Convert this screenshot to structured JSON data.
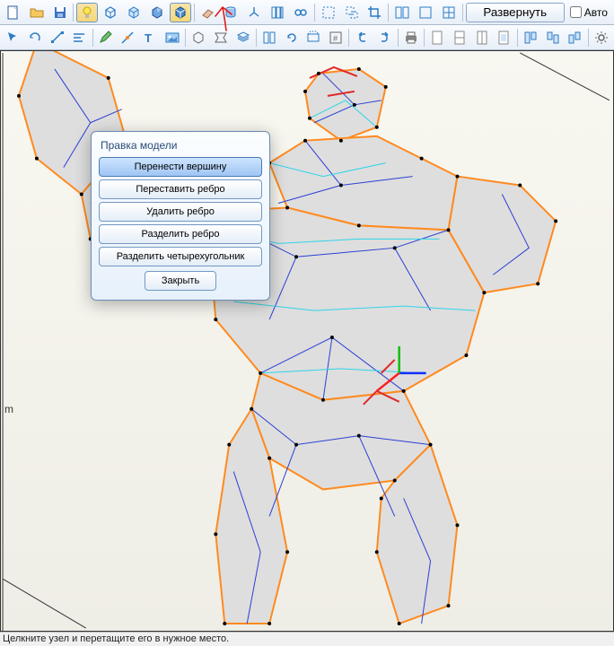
{
  "toolbar1": {
    "unfold_button": "Развернуть",
    "auto_checkbox": "Авто"
  },
  "dialog": {
    "title": "Правка модели",
    "btn_move_vertex": "Перенести вершину",
    "btn_move_edge": "Переставить ребро",
    "btn_delete_edge": "Удалить ребро",
    "btn_split_edge": "Разделить ребро",
    "btn_split_quad": "Разделить четырехугольник",
    "btn_close": "Закрыть"
  },
  "side_label": "m",
  "statusbar": "Целкните узел и перетащите его в нужное место.",
  "icons": {
    "new": "new-file-icon",
    "open": "open-folder-icon",
    "save": "save-icon",
    "lightbulb": "lightbulb-icon",
    "cube1": "cube-outline-icon",
    "cube2": "cube-wire-icon",
    "cube3": "cube-shaded-icon",
    "cube4": "cube-selected-icon",
    "eraser": "eraser-icon",
    "cylinder": "cylinder-icon",
    "axes": "axes-3d-icon",
    "columns": "columns-icon",
    "link": "link-icon",
    "select_box": "select-box-icon",
    "select_add": "select-add-icon",
    "crop": "crop-icon",
    "layout2": "layout-2col-icon",
    "layout1": "layout-single-icon",
    "grid": "grid-icon"
  }
}
